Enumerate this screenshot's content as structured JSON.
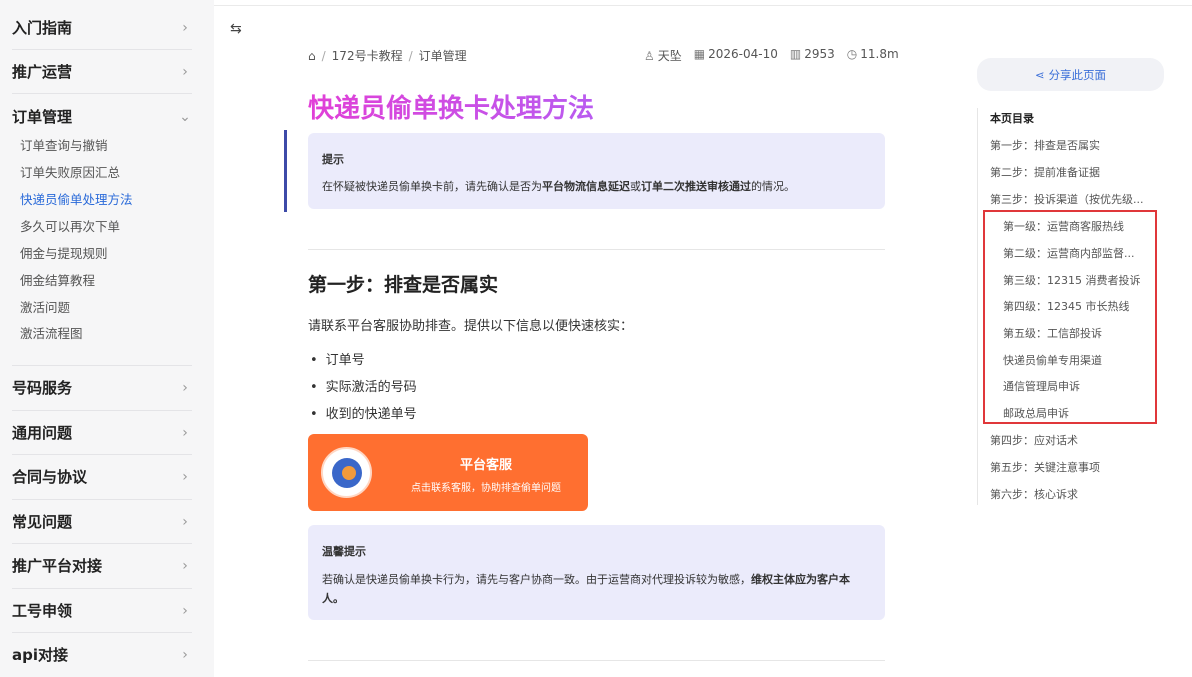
{
  "sidebar": {
    "sections": [
      {
        "label": "入门指南"
      },
      {
        "label": "推广运营"
      },
      {
        "label": "订单管理"
      },
      {
        "label": "号码服务"
      },
      {
        "label": "通用问题"
      },
      {
        "label": "合同与协议"
      },
      {
        "label": "常见问题"
      },
      {
        "label": "推广平台对接"
      },
      {
        "label": "工号申领"
      },
      {
        "label": "api对接"
      }
    ],
    "sub_items": [
      {
        "label": "订单查询与撤销"
      },
      {
        "label": "订单失败原因汇总"
      },
      {
        "label": "快递员偷单处理方法"
      },
      {
        "label": "多久可以再次下单"
      },
      {
        "label": "佣金与提现规则"
      },
      {
        "label": "佣金结算教程"
      },
      {
        "label": "激活问题"
      },
      {
        "label": "激活流程图"
      }
    ],
    "active_sub": "快递员偷单处理方法"
  },
  "breadcrumb": {
    "items": [
      "172号卡教程",
      "订单管理"
    ]
  },
  "meta": {
    "author": "天坠",
    "date": "2026-04-10",
    "words": "2953",
    "read_time": "11.8m"
  },
  "page": {
    "title": "快递员偷单换卡处理方法",
    "tip": {
      "heading": "提示",
      "text_a": "在怀疑被快递员偷单换卡前，请先确认是否为",
      "text_b": "平台物流信息延迟",
      "text_c": "或",
      "text_d": "订单二次推送审核通过",
      "text_e": "的情况。"
    },
    "step1_heading": "第一步：排查是否属实",
    "intro": "请联系平台客服协助排查。提供以下信息以便快速核实：",
    "bullets": [
      "订单号",
      "实际激活的号码",
      "收到的快递单号"
    ],
    "service_card": {
      "title": "平台客服",
      "subtitle": "点击联系客服，协助排查偷单问题"
    },
    "warm": {
      "heading": "温馨提示",
      "text_a": "若确认是快递员偷单换卡行为，请先与客户协商一致。由于运营商对代理投诉较为敏感，",
      "text_b": "维权主体应为客户本人。"
    }
  },
  "right": {
    "share_label": "分享此页面",
    "toc_title": "本页目录",
    "toc": [
      {
        "label": "第一步：排查是否属实",
        "indent": 0
      },
      {
        "label": "第二步：提前准备证据",
        "indent": 0
      },
      {
        "label": "第三步：投诉渠道（按优先级...",
        "indent": 0
      },
      {
        "label": "第一级：运营商客服热线",
        "indent": 1
      },
      {
        "label": "第二级：运营商内部监督...",
        "indent": 1
      },
      {
        "label": "第三级：12315 消费者投诉",
        "indent": 1
      },
      {
        "label": "第四级：12345 市长热线",
        "indent": 1
      },
      {
        "label": "第五级：工信部投诉",
        "indent": 1
      },
      {
        "label": "快递员偷单专用渠道",
        "indent": 1
      },
      {
        "label": "通信管理局申诉",
        "indent": 1
      },
      {
        "label": "邮政总局申诉",
        "indent": 1
      },
      {
        "label": "第四步：应对话术",
        "indent": 0
      },
      {
        "label": "第五步：关键注意事项",
        "indent": 0
      },
      {
        "label": "第六步：核心诉求",
        "indent": 0
      }
    ]
  },
  "colors": {
    "accent": "#2a6ad9",
    "title_gradient": "#e13fd7",
    "card": "#ff6f30",
    "highlight": "#e0373a"
  }
}
